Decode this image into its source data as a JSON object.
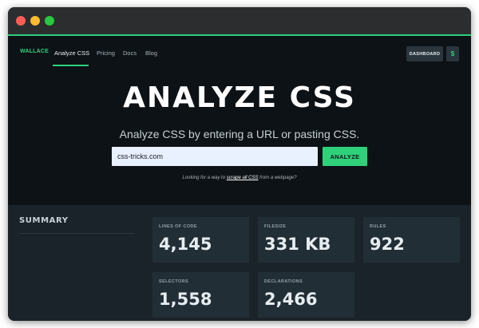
{
  "window": {
    "controls": [
      "close",
      "minimize",
      "maximize"
    ]
  },
  "nav": {
    "brand": "WALLACE",
    "links": [
      {
        "label": "Analyze CSS",
        "active": true
      },
      {
        "label": "Pricing",
        "active": false
      },
      {
        "label": "Docs",
        "active": false
      },
      {
        "label": "Blog",
        "active": false
      }
    ],
    "dashboard_label": "DASHBOARD",
    "pricing_icon_label": "$"
  },
  "hero": {
    "title": "ANALYZE CSS",
    "subtitle": "Analyze CSS by entering a URL or pasting CSS.",
    "input_value": "css-tricks.com",
    "button_label": "ANALYZE",
    "hint_before": "Looking for a way to ",
    "hint_link": "scrape all CSS",
    "hint_after": " from a webpage?"
  },
  "summary": {
    "title": "SUMMARY",
    "cards": [
      {
        "label": "LINES OF CODE",
        "value": "4,145"
      },
      {
        "label": "FILESIZE",
        "value": "331 KB"
      },
      {
        "label": "RULES",
        "value": "922"
      },
      {
        "label": "SELECTORS",
        "value": "1,558"
      },
      {
        "label": "DECLARATIONS",
        "value": "2,466"
      }
    ]
  },
  "colors": {
    "accent": "#2ed17a",
    "hero_bg": "#0c1216",
    "summary_bg": "#1a2329",
    "card_bg": "#222e36"
  }
}
